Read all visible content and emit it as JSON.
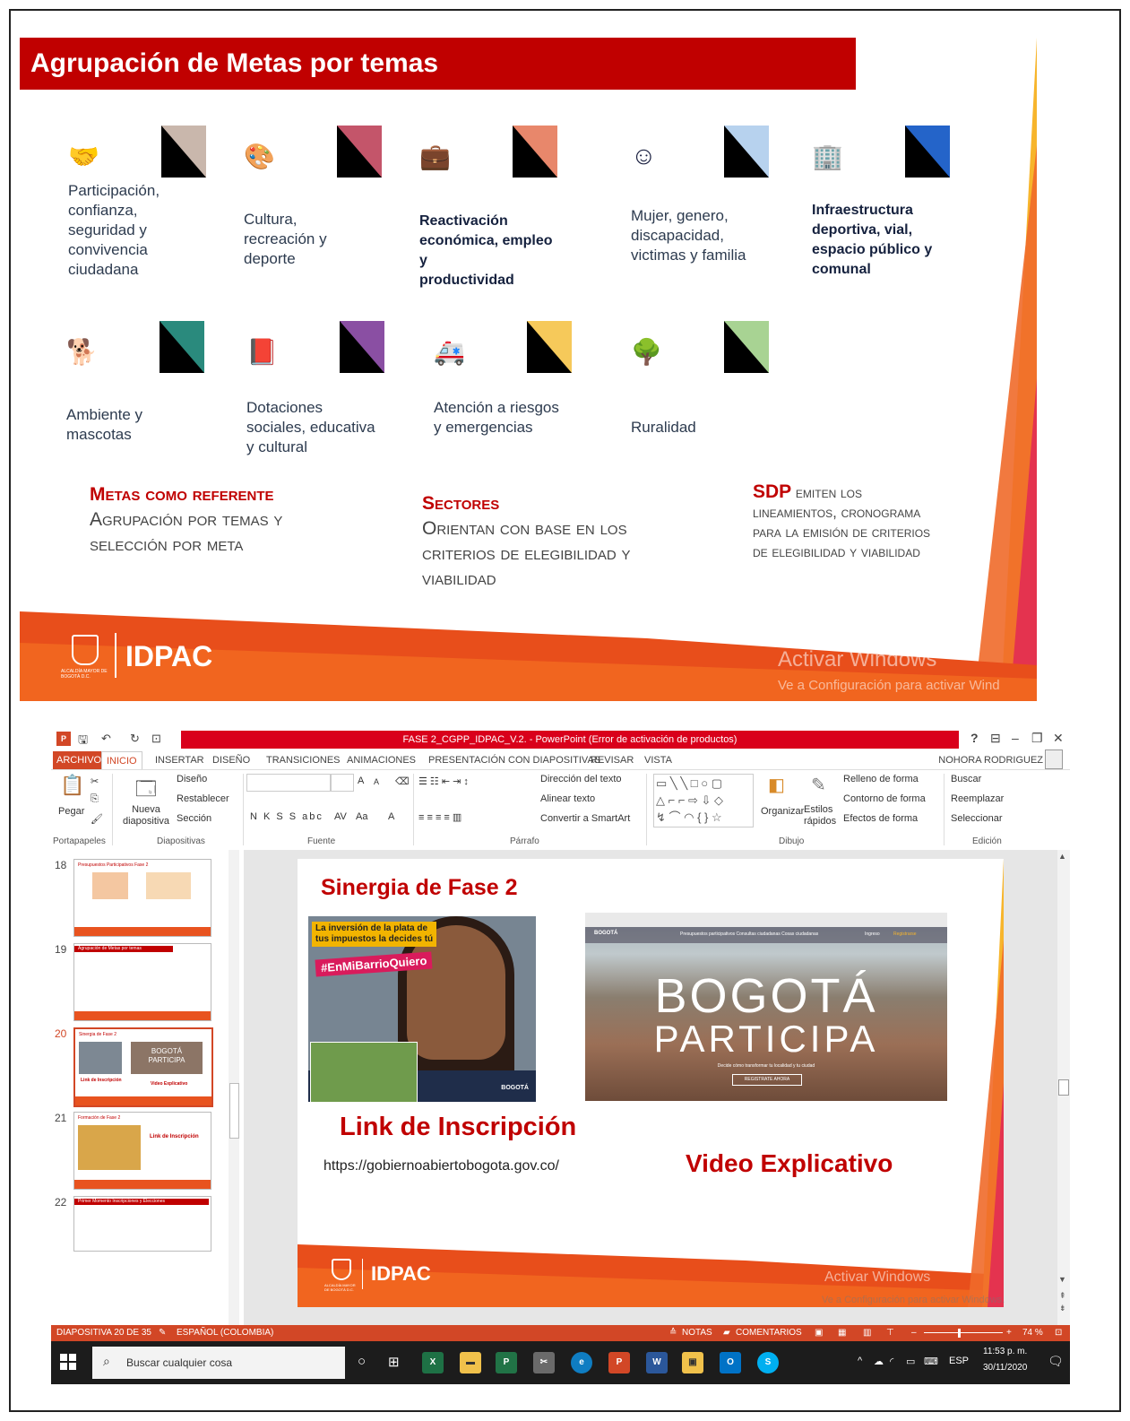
{
  "slide1": {
    "title": "Agrupación de Metas por temas",
    "tiles": [
      {
        "label": "Participación,\nconfianza,\nseguridad y\nconvivencia\nciudadana",
        "icon": "handshake-icon",
        "color": "#c9b7ac"
      },
      {
        "label": "Cultura,\nrecreación y\ndeporte",
        "icon": "palette-icon",
        "color": "#c4556a"
      },
      {
        "label": "Reactivación\neconómica, empleo y\nproductividad",
        "icon": "briefcase-icon",
        "color": "#e8876b"
      },
      {
        "label": "Mujer, genero,\ndiscapacidad,\nvictimas y familia",
        "icon": "people-icon",
        "color": "#b7d2ee"
      },
      {
        "label": "Infraestructura\ndeportiva, vial,\nespacio público y\ncomunal",
        "icon": "building-icon",
        "color": "#2464c9"
      },
      {
        "label": "Ambiente y\nmascotas",
        "icon": "dog-icon",
        "color": "#2a8a7d"
      },
      {
        "label": "Dotaciones\nsociales, educativa\ny cultural",
        "icon": "book-icon",
        "color": "#8a4fa3"
      },
      {
        "label": "Atención a riesgos\ny emergencias",
        "icon": "ambulance-icon",
        "color": "#f6c95a"
      },
      {
        "label": "Ruralidad",
        "icon": "tree-icon",
        "color": "#a8d393"
      }
    ],
    "block1": {
      "red": "Metas como referente",
      "text": "Agrupación por temas y selección por meta"
    },
    "block2": {
      "red": "Sectores",
      "text": "Orientan con base en los criterios de elegibilidad y viabilidad"
    },
    "block3": {
      "red": "SDP",
      "text": "emiten los lineamientos, cronograma para la emisión de criterios de elegibilidad y viabilidad"
    },
    "footer": {
      "brand": "IDPAC",
      "crest": "ALCALDÍA MAYOR DE BOGOTÁ D.C."
    },
    "watermark": {
      "line1": "Activar Windows",
      "line2": "Ve a Configuración para activar Wind"
    }
  },
  "ppt": {
    "window_title": "FASE 2_CGPP_IDPAC_V.2. - PowerPoint (Error de activación de productos)",
    "tabs": [
      "ARCHIVO",
      "INICIO",
      "INSERTAR",
      "DISEÑO",
      "TRANSICIONES",
      "ANIMACIONES",
      "PRESENTACIÓN CON DIAPOSITIVAS",
      "REVISAR",
      "VISTA"
    ],
    "user": "NOHORA RODRIGUEZ",
    "ribbon": {
      "pegar": "Pegar",
      "nueva_diap": "Nueva\ndiapositiva",
      "diseno": "Diseño",
      "restablecer": "Restablecer",
      "seccion": "Sección",
      "direccion_texto": "Dirección del texto",
      "alinear_texto": "Alinear texto",
      "convertir_smartart": "Convertir a SmartArt",
      "organizar": "Organizar",
      "estilos_rapidos": "Estilos\nrápidos",
      "relleno": "Relleno de forma",
      "contorno": "Contorno de forma",
      "efectos": "Efectos de forma",
      "buscar": "Buscar",
      "reemplazar": "Reemplazar",
      "seleccionar": "Seleccionar",
      "grp_portapapeles": "Portapapeles",
      "grp_diapositivas": "Diapositivas",
      "grp_fuente": "Fuente",
      "grp_parrafo": "Párrafo",
      "grp_dibujo": "Dibujo",
      "grp_edicion": "Edición",
      "font_buttons": "N  K  S  S  abc",
      "av": "AV",
      "aa": "Aa",
      "a_big": "A",
      "a_small": "A"
    },
    "thumbnails": [
      {
        "num": "18",
        "title": "Presupuestos Participativos Fase 2"
      },
      {
        "num": "19",
        "title": "Agrupación de Metas por temas"
      },
      {
        "num": "20",
        "title": "Sinergia de Fase 2"
      },
      {
        "num": "21",
        "title": "Formación de Fase 2"
      },
      {
        "num": "22",
        "title": "Primer Momento Inscripciones y Elecciones"
      }
    ],
    "thumb20_extra": {
      "a": "BOGOTÁ",
      "b": "PARTICIPA",
      "c": "Link de Inscripción",
      "d": "Video Explicativo"
    },
    "thumb21_extra": "Link de Inscripción",
    "slide2": {
      "title": "Sinergia de Fase 2",
      "promo_tag1": "La inversión de la plata de\ntus impuestos la decides tú",
      "promo_tag2": "#EnMiBarrioQuiero",
      "promo_brand": "BOGOTÁ",
      "bp_line1": "BOGOTÁ",
      "bp_line2": "PARTICIPA",
      "bp_brand": "BOGOTÁ",
      "bp_nav": "Presupuestos participativos   Consultas ciudadanas   Cosas ciudadanas",
      "bp_login": "Ingreso",
      "bp_register": "Registrarse",
      "bp_sub": "Decide cómo transformar tu localidad y tu ciudad",
      "bp_button": "REGISTRATE AHORA",
      "link_title": "Link de Inscripción",
      "url": "https://gobiernoabiertobogota.gov.co/",
      "video_title": "Video Explicativo",
      "brand": "IDPAC",
      "crest": "ALCALDÍA MAYOR DE BOGOTÁ D.C.",
      "watermark1": "Activar Windows",
      "watermark2": "Ve a Configuración para activar Windows."
    },
    "status": {
      "slide": "DIAPOSITIVA 20 DE 35",
      "lang": "ESPAÑOL (COLOMBIA)",
      "notas": "NOTAS",
      "comentarios": "COMENTARIOS",
      "zoom": "74 %"
    },
    "taskbar": {
      "search": "Buscar cualquier cosa",
      "lang": "ESP",
      "time": "11:53 p. m.",
      "date": "30/11/2020"
    }
  }
}
